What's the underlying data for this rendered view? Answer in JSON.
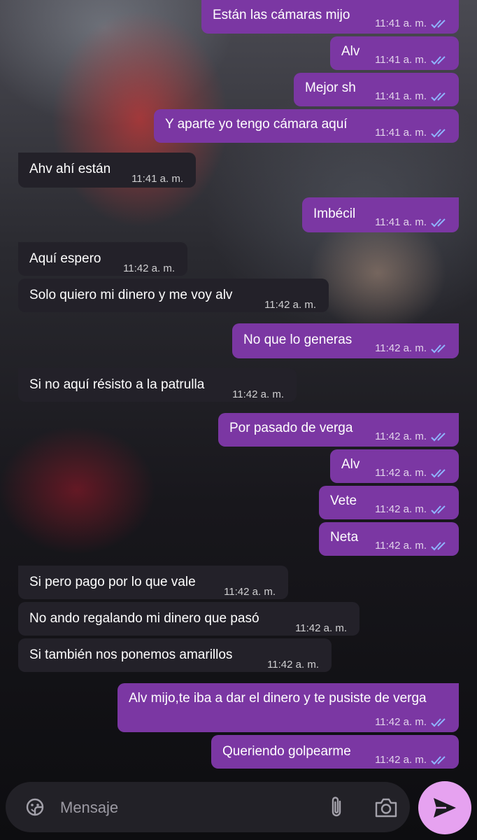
{
  "messages": [
    {
      "text": "Están las cámaras mijo",
      "time": "11:41 a. m.",
      "outgoing": true
    },
    {
      "text": "Alv",
      "time": "11:41 a. m.",
      "outgoing": true
    },
    {
      "text": "Mejor sh",
      "time": "11:41 a. m.",
      "outgoing": true
    },
    {
      "text": "Y aparte yo tengo cámara aquí",
      "time": "11:41 a. m.",
      "outgoing": true
    },
    {
      "text": "Ahv ahí están",
      "time": "11:41 a. m.",
      "outgoing": false
    },
    {
      "text": "Imbécil",
      "time": "11:41 a. m.",
      "outgoing": true
    },
    {
      "text": "Aquí espero",
      "time": "11:42 a. m.",
      "outgoing": false
    },
    {
      "text": "Solo quiero mi dinero y me voy alv",
      "time": "11:42 a. m.",
      "outgoing": false
    },
    {
      "text": "No que lo generas",
      "time": "11:42 a. m.",
      "outgoing": true
    },
    {
      "text": "Si no aquí résisto a la patrulla",
      "time": "11:42 a. m.",
      "outgoing": false
    },
    {
      "text": "Por pasado de verga",
      "time": "11:42 a. m.",
      "outgoing": true
    },
    {
      "text": "Alv",
      "time": "11:42 a. m.",
      "outgoing": true
    },
    {
      "text": "Vete",
      "time": "11:42 a. m.",
      "outgoing": true
    },
    {
      "text": "Neta",
      "time": "11:42 a. m.",
      "outgoing": true
    },
    {
      "text": "Si pero pago por lo que vale",
      "time": "11:42 a. m.",
      "outgoing": false
    },
    {
      "text": "No ando regalando mi dinero que pasó",
      "time": "11:42 a. m.",
      "outgoing": false
    },
    {
      "text": "Si también nos ponemos amarillos",
      "time": "11:42 a. m.",
      "outgoing": false
    },
    {
      "text": "Alv mijo,te iba a dar el dinero y te pusiste de verga",
      "time": "11:42 a. m.",
      "outgoing": true
    },
    {
      "text": "Queriendo golpearme",
      "time": "11:42 a. m.",
      "outgoing": true
    }
  ],
  "composer": {
    "placeholder": "Mensaje",
    "emoji_icon": "sticker-emoji-icon",
    "attach_icon": "paperclip-icon",
    "camera_icon": "camera-icon",
    "send_icon": "send-icon"
  },
  "colors": {
    "outgoing_bubble": "#7b37a3",
    "incoming_bubble": "#232129",
    "read_ticks": "#8fb4ff",
    "send_button": "#e6a2f0"
  }
}
